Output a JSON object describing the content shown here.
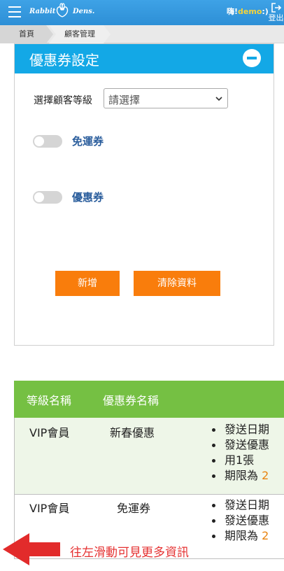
{
  "header": {
    "brand_left": "Rabbit",
    "brand_right": "Dens.",
    "greeting_prefix": "嗨!",
    "user": "demo",
    "greeting_suffix": ":)",
    "logout_label": "登出"
  },
  "breadcrumb": [
    "首頁",
    "顧客管理"
  ],
  "coupon_panel": {
    "title": "優惠券設定",
    "level_label": "選擇顧客等級",
    "level_select_value": "請選擇",
    "toggles": [
      {
        "label": "免運券",
        "on": false
      },
      {
        "label": "優惠券",
        "on": false
      }
    ],
    "add_button": "新增",
    "clear_button": "清除資料"
  },
  "table": {
    "headers": [
      "等級名稱",
      "優惠券名稱"
    ],
    "rows": [
      {
        "level": "VIP會員",
        "coupon": "新春優惠",
        "details": [
          "發送日期",
          "發送優惠",
          "用1張",
          "期限為",
          "2"
        ]
      },
      {
        "level": "VIP會員",
        "coupon": "免運券",
        "details": [
          "發送日期",
          "發送優惠",
          "期限為",
          "2"
        ]
      }
    ]
  },
  "hint": "往左滑動可見更多資訊",
  "colors": {
    "topbar": "#2d8fd6",
    "panel_header": "#13a8e6",
    "table_header": "#75c043",
    "button": "#f97d0c",
    "hint": "#e53232",
    "highlight": "#e8830f"
  }
}
